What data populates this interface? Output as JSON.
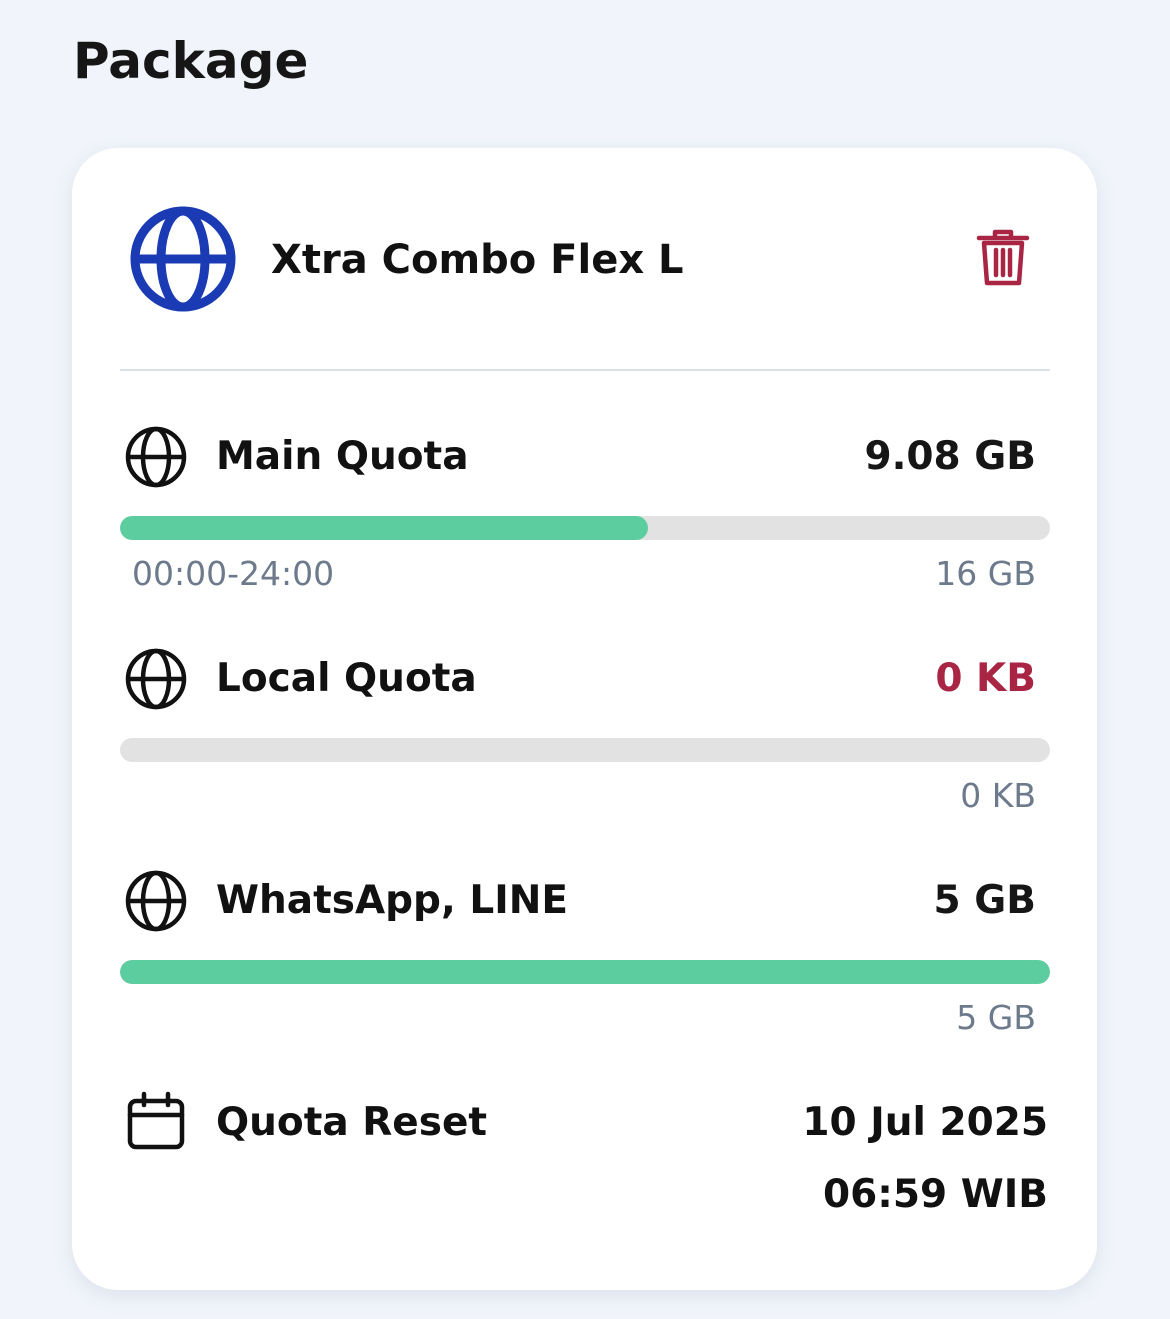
{
  "section": {
    "title": "Package"
  },
  "package": {
    "name": "Xtra Combo Flex L",
    "icon": "globe-icon",
    "brand_color": "#1a3bb3",
    "delete_icon": "trash-icon",
    "delete_color": "#a82544"
  },
  "quotas": [
    {
      "icon": "globe-icon",
      "label": "Main Quota",
      "remaining": "9.08 GB",
      "time_window": "00:00-24:00",
      "total": "16 GB",
      "fill_fraction": 0.568,
      "value_color": "#161616"
    },
    {
      "icon": "globe-icon",
      "label": "Local Quota",
      "remaining": "0 KB",
      "time_window": "",
      "total": "0 KB",
      "fill_fraction": 0,
      "value_color": "#a82544"
    },
    {
      "icon": "globe-icon",
      "label": "WhatsApp, LINE",
      "remaining": "5 GB",
      "time_window": "",
      "total": "5 GB",
      "fill_fraction": 1,
      "value_color": "#161616"
    }
  ],
  "reset": {
    "icon": "calendar-icon",
    "label": "Quota Reset",
    "date": "10 Jul 2025",
    "time": "06:59 WIB"
  },
  "colors": {
    "background": "#f1f5fb",
    "bar_fill": "#5ccd9f",
    "bar_track": "#e2e2e2",
    "muted_text": "#6c7a8c"
  }
}
